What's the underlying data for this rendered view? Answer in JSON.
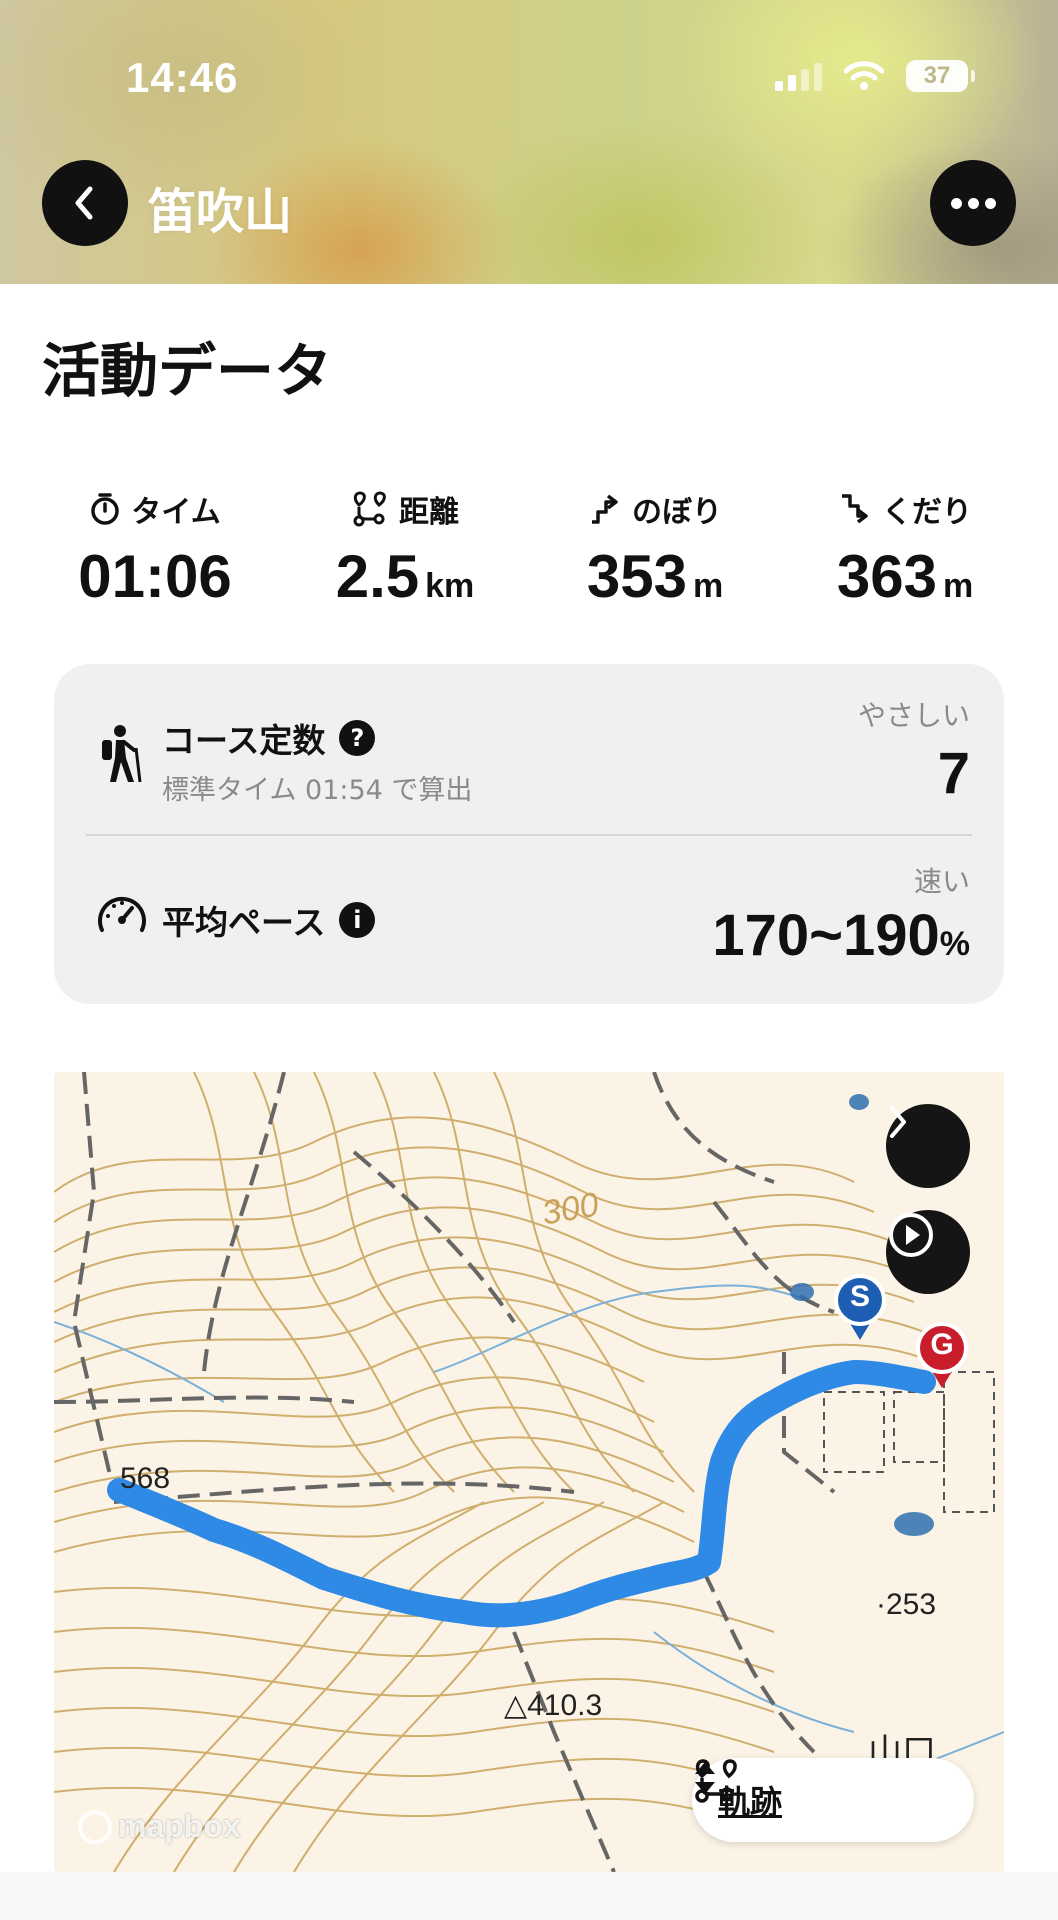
{
  "status_bar": {
    "time": "14:46",
    "battery": "37"
  },
  "header": {
    "title": "笛吹山",
    "back_icon": "chevron-left-icon",
    "more_icon": "ellipsis-icon"
  },
  "section": {
    "title": "活動データ"
  },
  "stats": [
    {
      "icon": "stopwatch-icon",
      "label": "タイム",
      "value": "01:06",
      "unit": ""
    },
    {
      "icon": "route-icon",
      "label": "距離",
      "value": "2.5",
      "unit": "km"
    },
    {
      "icon": "ascent-icon",
      "label": "のぼり",
      "value": "353",
      "unit": "m"
    },
    {
      "icon": "descent-icon",
      "label": "くだり",
      "value": "363",
      "unit": "m"
    }
  ],
  "course": {
    "title": "コース定数",
    "help_icon": "question-icon",
    "subtitle": "標準タイム 01:54 で算出",
    "difficulty": "やさしい",
    "value": "7"
  },
  "pace": {
    "title": "平均ペース",
    "info_icon": "info-icon",
    "tag": "速い",
    "value": "170~190",
    "unit": "%"
  },
  "map": {
    "labels": {
      "contour_300": "300",
      "elev_568": "568",
      "elev_253": "·253",
      "triangulation": "△410.3",
      "place": "山口"
    },
    "start_marker": "S",
    "goal_marker": "G",
    "attribution": "mapbox",
    "track_button": "軌跡",
    "track_color": "#2f8ae6",
    "contour_color": "#c9a25a"
  }
}
